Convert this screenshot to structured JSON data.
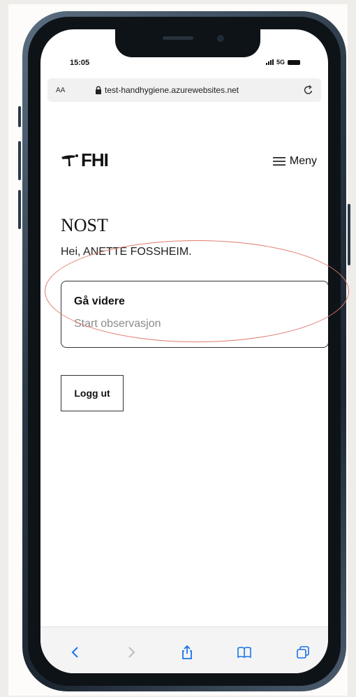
{
  "status": {
    "time": "15:05",
    "network": "5G"
  },
  "browser": {
    "text_size_label": "AA",
    "url": "test-handhygiene.azurewebsites.net"
  },
  "header": {
    "logo_text": "FHI",
    "menu_label": "Meny"
  },
  "main": {
    "title": "NOST",
    "greeting": "Hei, ANETTE FOSSHEIM.",
    "card": {
      "title": "Gå videre",
      "subtitle": "Start observasjon"
    },
    "logout_label": "Logg ut"
  },
  "colors": {
    "highlight": "#e07a6e",
    "toolbar_icon": "#1a73e8"
  }
}
